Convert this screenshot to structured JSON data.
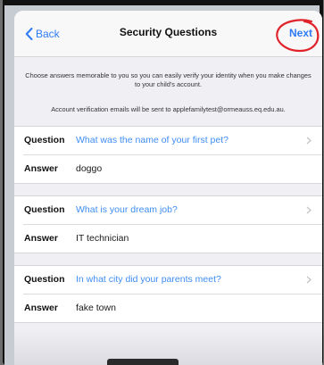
{
  "nav": {
    "back_label": "Back",
    "title": "Security Questions",
    "next_label": "Next"
  },
  "info": {
    "line1": "Choose answers memorable to you so you can easily verify your identity when you make changes to your child's account.",
    "line2": "Account verification emails will be sent to applefamilytest@ormeauss.eq.edu.au."
  },
  "labels": {
    "question": "Question",
    "answer": "Answer"
  },
  "questions": [
    {
      "question": "What was the name of your first pet?",
      "answer": "doggo"
    },
    {
      "question": "What is your dream job?",
      "answer": "IT technician"
    },
    {
      "question": "In what city did your parents meet?",
      "answer": "fake town"
    }
  ],
  "colors": {
    "accent": "#2f7bf6",
    "annotation": "#e0232b"
  }
}
